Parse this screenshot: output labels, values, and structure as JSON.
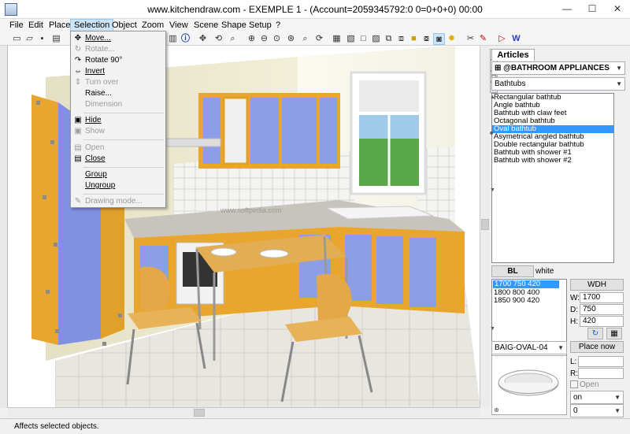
{
  "window": {
    "title": "www.kitchendraw.com - EXEMPLE 1 - (Account=2059345792:0 0=0+0+0) 00:00",
    "minimize": "—",
    "maximize": "☐",
    "close": "✕"
  },
  "menu": [
    "File",
    "Edit",
    "Place",
    "Selection",
    "Object",
    "Zoom",
    "View",
    "Scene",
    "Shape",
    "Setup",
    "?"
  ],
  "selection_menu": {
    "items": [
      {
        "label": "Move...",
        "icon": "✥",
        "enabled": true
      },
      {
        "label": "Rotate...",
        "icon": "↻",
        "enabled": false
      },
      {
        "label": "Rotate 90°",
        "icon": "↷",
        "enabled": true
      },
      {
        "label": "Invert",
        "icon": "⇔",
        "enabled": true
      },
      {
        "label": "Turn over",
        "icon": "⇕",
        "enabled": false
      },
      {
        "label": "Raise...",
        "icon": "",
        "enabled": true
      },
      {
        "label": "Dimension",
        "icon": "",
        "enabled": false
      },
      {
        "label": "Hide",
        "icon": "▣",
        "enabled": true
      },
      {
        "label": "Show",
        "icon": "▣",
        "enabled": false
      },
      {
        "label": "Open",
        "icon": "▤",
        "enabled": false
      },
      {
        "label": "Close",
        "icon": "▤",
        "enabled": true
      },
      {
        "label": "Group",
        "icon": "",
        "enabled": true
      },
      {
        "label": "Ungroup",
        "icon": "",
        "enabled": true
      },
      {
        "label": "Drawing mode...",
        "icon": "✎",
        "enabled": false
      }
    ]
  },
  "status": "Affects selected objects.",
  "panel": {
    "tab": "Articles",
    "catalog": "@BATHROOM APPLIANCES",
    "category": "Bathtubs",
    "articles": [
      "Rectangular bathtub",
      "Angle bathtub",
      "Bathtub with claw feet",
      "Octagonal bathtub",
      "Oval bathtub",
      "Asymetrical angled bathtub",
      "Double rectangular bathtub",
      "Bathtub with shower #1",
      "Bathtub with shower #2"
    ],
    "selected_article": "Oval bathtub",
    "finish_code": "BL",
    "finish_name": "white",
    "sizes": [
      "1700  750  420",
      "1800  800  400",
      "1850  900  420"
    ],
    "wdh_label": "WDH",
    "w_label": "W:",
    "w_value": "1700",
    "d_label": "D:",
    "d_value": "750",
    "h_label": "H:",
    "h_value": "420",
    "reference": "BAIG-OVAL-04",
    "place_now": "Place now",
    "l_label": "L:",
    "r_label": "R:",
    "open_label": "Open",
    "on_value": "on",
    "zero_value": "0"
  },
  "watermark": "www.softpedia.com",
  "toolbar_icons": [
    "new-icon",
    "open-icon",
    "save-icon",
    "print-icon",
    "cut-icon",
    "copy-icon",
    "paste-icon",
    "delete-icon",
    "undo-icon",
    "redo-icon",
    "info-icon",
    "move-icon",
    "zoom-in-icon",
    "zoom-out-icon",
    "render-icon"
  ]
}
